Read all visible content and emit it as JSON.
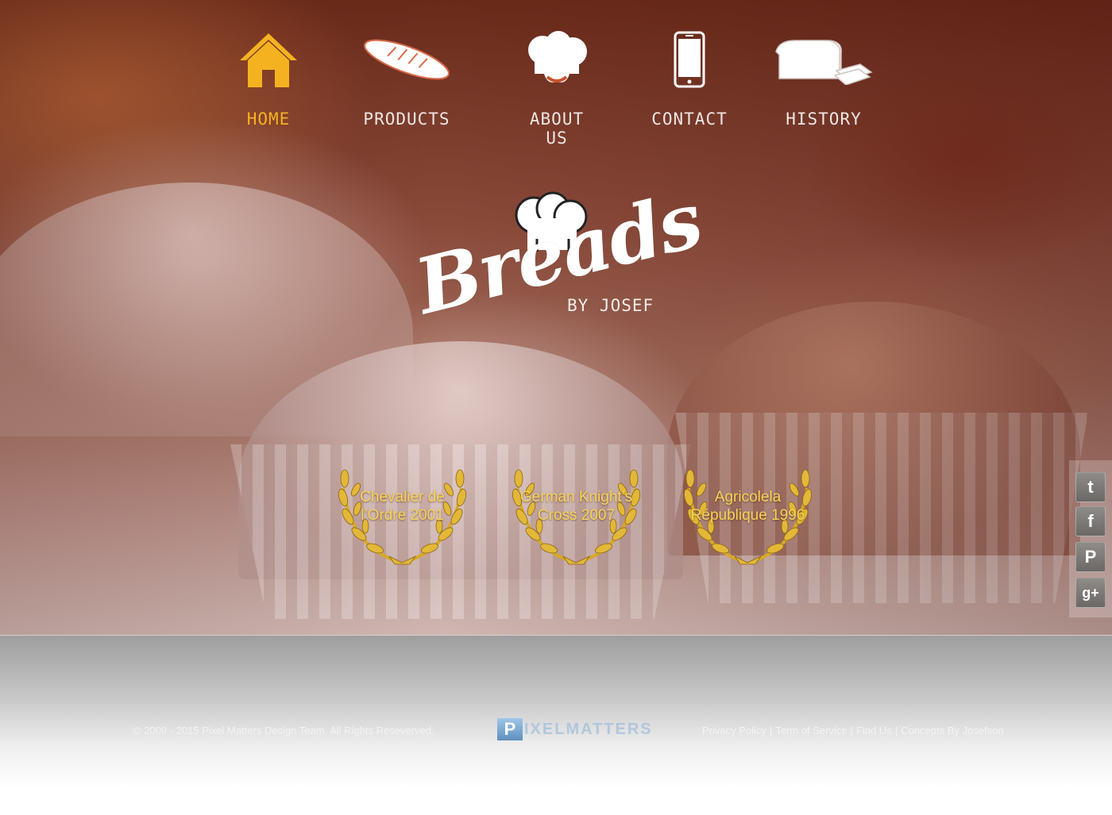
{
  "nav": {
    "items": [
      {
        "label": "HOME",
        "icon": "home-icon",
        "active": true
      },
      {
        "label": "PRODUCTS",
        "icon": "baguette-icon",
        "active": false
      },
      {
        "label": "ABOUT US",
        "icon": "chef-hat-icon",
        "active": false
      },
      {
        "label": "CONTACT",
        "icon": "phone-icon",
        "active": false
      },
      {
        "label": "HISTORY",
        "icon": "bread-loaf-icon",
        "active": false
      }
    ],
    "active_color": "#f5b220",
    "inactive_color": "#f0e6e2"
  },
  "logo": {
    "word": "Breads",
    "sub": "BY JOSEF"
  },
  "awards": [
    {
      "text": "Chevalier de l’Ordre 2001"
    },
    {
      "text": "German Knight’s Cross 2007"
    },
    {
      "text": "Agricolela République 1996"
    }
  ],
  "social": [
    {
      "name": "twitter",
      "glyph": "t"
    },
    {
      "name": "facebook",
      "glyph": "f"
    },
    {
      "name": "pinterest",
      "glyph": "P"
    },
    {
      "name": "google-plus",
      "glyph": "g+"
    }
  ],
  "footer": {
    "copyright": "© 2009 - 2015 Pixel Matters Design Team. All Rights Reseverved.",
    "brand_initial": "P",
    "brand_rest": "IXELMATTERS",
    "links": [
      "Privacy Policy",
      "Term of Service",
      "Find Us",
      "Concepts By Josefson"
    ],
    "separator": "|"
  }
}
